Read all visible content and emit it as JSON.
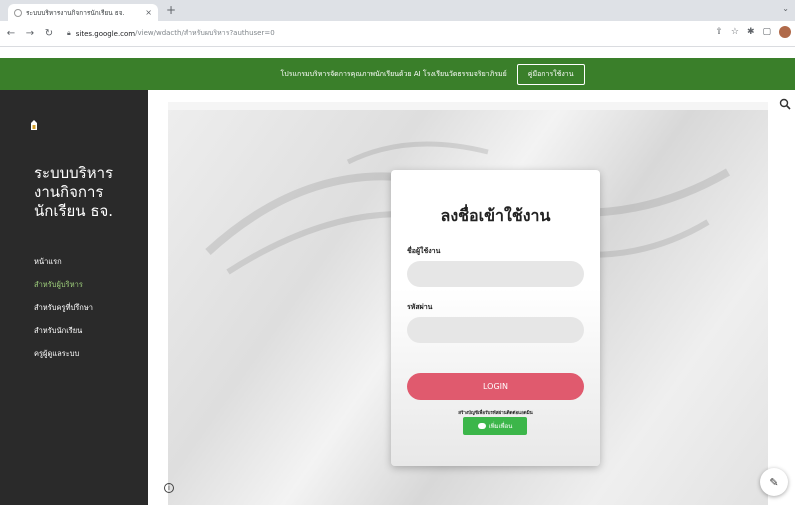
{
  "browser": {
    "tab_title": "ระบบบริหารงานกิจการนักเรียน ธจ.",
    "tab_close": "×",
    "new_tab": "+",
    "url_host": "sites.google.com",
    "url_path": "/view/wdacth/สำหรับผบริหาร?authuser=0"
  },
  "banner": {
    "text": "โปรแกรมบริหารจัดการคุณภาพนักเรียนด้วย AI โรงเรียนวัดธรรมจริยาภิรมย์",
    "button_label": "คู่มือการใช้งาน"
  },
  "sidebar": {
    "site_title_lines": [
      "ระบบบริหาร",
      "งานกิจการ",
      "นักเรียน ธจ."
    ],
    "nav_items": [
      {
        "label": "หน้าแรก"
      },
      {
        "label": "สำหรับผู้บริหาร"
      },
      {
        "label": "สำหรับครูที่ปรึกษา"
      },
      {
        "label": "สำหรับนักเรียน"
      },
      {
        "label": "ครูผู้ดูแลระบบ"
      }
    ]
  },
  "login_card": {
    "title": "ลงชื่อเข้าใช้งาน",
    "username_label": "ชื่อผู้ใช้งาน",
    "password_label": "รหัสผ่าน",
    "login_button": "LOGIN",
    "signup_text": "สร้างบัญชีเพื่อรับรหัสผ่านติดต่อแอดมิน",
    "line_button": "เพิ่มเพื่อน"
  },
  "colors": {
    "banner_green": "#3a7f2a",
    "sidebar_bg": "#2a2a2a",
    "active_nav": "#9ccc7a",
    "login_button": "#e05a6e",
    "line_green": "#3cb64a"
  }
}
